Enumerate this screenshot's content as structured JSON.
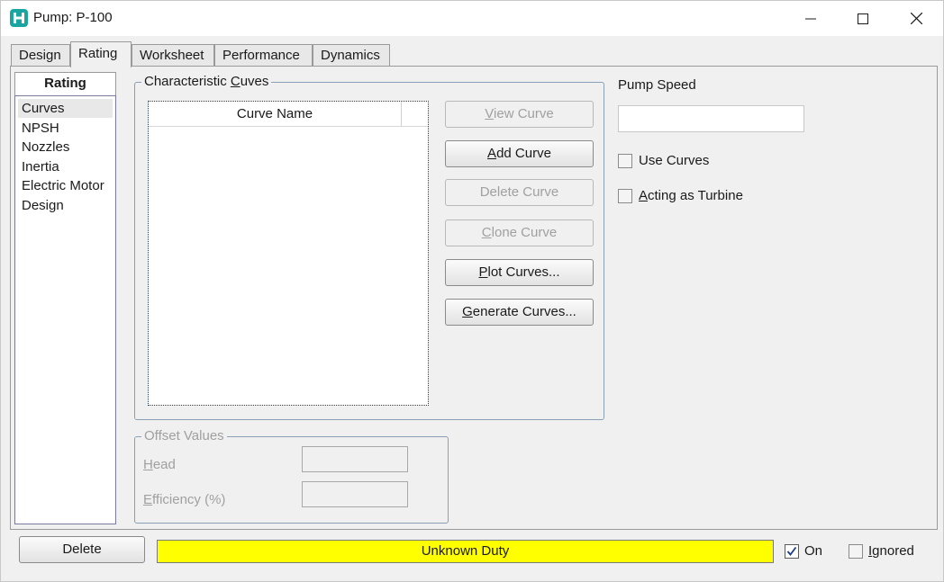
{
  "window": {
    "title": "Pump: P-100",
    "icon": "app-logo-icon",
    "controls": [
      "minimize-icon",
      "maximize-icon",
      "close-icon"
    ]
  },
  "tabs": [
    {
      "label": "Design",
      "active": false
    },
    {
      "label": "Rating",
      "active": true
    },
    {
      "label": "Worksheet",
      "active": false
    },
    {
      "label": "Performance",
      "active": false
    },
    {
      "label": "Dynamics",
      "active": false
    }
  ],
  "sidebar": {
    "header": "Rating",
    "items": [
      {
        "label": "Curves",
        "selected": true
      },
      {
        "label": "NPSH",
        "selected": false
      },
      {
        "label": "Nozzles",
        "selected": false
      },
      {
        "label": "Inertia",
        "selected": false
      },
      {
        "label": "Electric Motor",
        "selected": false
      },
      {
        "label": "Design",
        "selected": false
      }
    ]
  },
  "characteristic_curves": {
    "legend_pre": "Characteristic ",
    "legend_key": "C",
    "legend_post": "uves",
    "column_header": "Curve Name",
    "rows": [],
    "buttons": {
      "view": {
        "pre": "",
        "key": "V",
        "post": "iew Curve",
        "enabled": false
      },
      "add": {
        "pre": "",
        "key": "A",
        "post": "dd Curve",
        "enabled": true
      },
      "delete": {
        "pre": "",
        "key": "",
        "post": "Delete Curve",
        "enabled": false
      },
      "clone": {
        "pre": "",
        "key": "C",
        "post": "lone Curve",
        "enabled": false
      },
      "plot": {
        "pre": "",
        "key": "P",
        "post": "lot Curves...",
        "enabled": true
      },
      "generate": {
        "pre": "",
        "key": "G",
        "post": "enerate Curves...",
        "enabled": true
      }
    }
  },
  "pump_speed": {
    "label": "Pump Speed",
    "value": "",
    "use_curves": {
      "label": "Use Curves",
      "checked": false
    },
    "acting_as_turbine": {
      "key": "A",
      "label_post": "cting as Turbine",
      "checked": false
    }
  },
  "offset_values": {
    "legend": "Offset Values",
    "head": {
      "key": "H",
      "label_post": "ead",
      "value": ""
    },
    "efficiency": {
      "key": "E",
      "label_post": "fficiency (%)",
      "value": ""
    }
  },
  "footer": {
    "delete_label": "Delete",
    "status_text": "Unknown Duty",
    "status_color": "#ffff00",
    "on": {
      "label": "On",
      "checked": true
    },
    "ignored": {
      "key": "I",
      "label_post": "gnored",
      "checked": false
    }
  }
}
